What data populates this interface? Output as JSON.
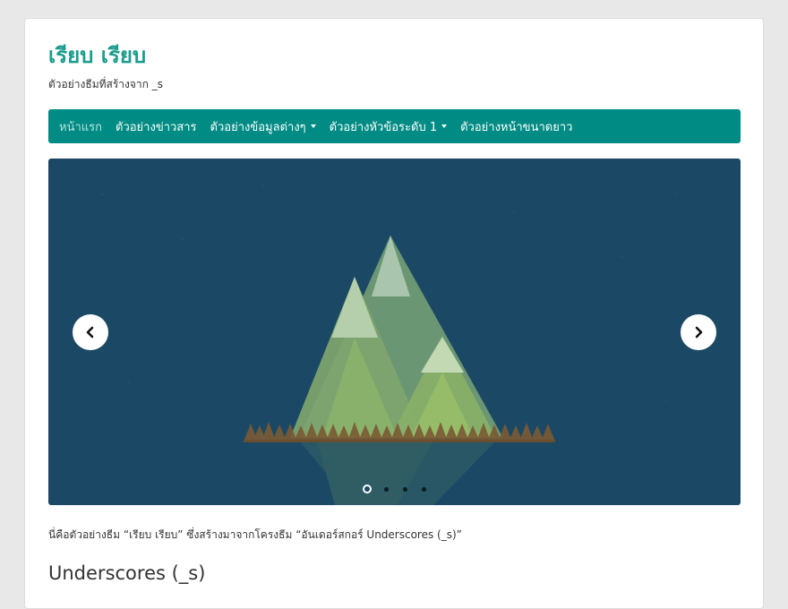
{
  "site": {
    "title": "เรียบ เรียบ",
    "description": "ตัวอย่างธีมที่สร้างจาก _s"
  },
  "nav": {
    "items": [
      {
        "label": "หน้าแรก",
        "active": true,
        "dropdown": false
      },
      {
        "label": "ตัวอย่างข่าวสาร",
        "active": false,
        "dropdown": false
      },
      {
        "label": "ตัวอย่างข้อมูลต่างๆ",
        "active": false,
        "dropdown": true
      },
      {
        "label": "ตัวอย่างหัวข้อระดับ 1",
        "active": false,
        "dropdown": true
      },
      {
        "label": "ตัวอย่างหน้าขนาดยาว",
        "active": false,
        "dropdown": false
      }
    ]
  },
  "slider": {
    "prev_icon": "chevron-left-icon",
    "next_icon": "chevron-right-icon",
    "slide_count": 4,
    "active_index": 0
  },
  "content": {
    "intro": "นี่คือตัวอย่างธีม “เรียบ เรียบ” ซึ่งสร้างมาจากโครงธีม “อันเดอร์สกอร์ Underscores (_s)”",
    "heading": "Underscores (_s)"
  },
  "colors": {
    "accent": "#008c84",
    "title": "#1a9c8c",
    "slide_bg": "#1b4965"
  }
}
